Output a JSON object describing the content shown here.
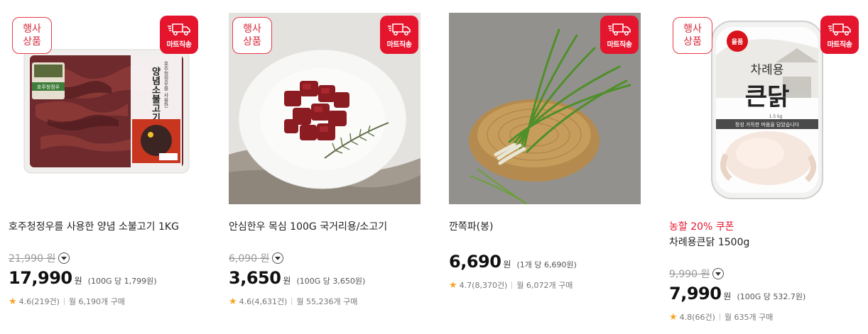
{
  "colors": {
    "accent_red": "#e5152e",
    "star": "#f5a623"
  },
  "products": [
    {
      "event_badge": [
        "행사",
        "상품"
      ],
      "delivery_badge": "마트직송",
      "title": "호주청정우를 사용한 양념 소불고기 1KG",
      "original_price": "21,990",
      "original_unit": "원",
      "price": "17,990",
      "price_unit": "원",
      "unit_price": "(100G 당 1,799원)",
      "rating": "4.6",
      "reviews": "(219건)",
      "monthly_sales": "월 6,190개 구매",
      "image_label": [
        "호주청정우를 사용한",
        "양념소불고기"
      ],
      "image_sublabel": "호주청정우"
    },
    {
      "event_badge": [
        "행사",
        "상품"
      ],
      "delivery_badge": "마트직송",
      "title": "안심한우 목심 100G 국거리용/소고기",
      "original_price": "6,090",
      "original_unit": "원",
      "price": "3,650",
      "price_unit": "원",
      "unit_price": "(100G 당 3,650원)",
      "rating": "4.6",
      "reviews": "(4,631건)",
      "monthly_sales": "월 55,236개 구매"
    },
    {
      "delivery_badge": "마트직송",
      "title": "깐쪽파(봉)",
      "price": "6,690",
      "price_unit": "원",
      "unit_price": "(1개 당 6,690원)",
      "rating": "4.7",
      "reviews": "(8,370건)",
      "monthly_sales": "월 6,072개 구매"
    },
    {
      "event_badge": [
        "행사",
        "상품"
      ],
      "delivery_badge": "마트직송",
      "coupon": "농할 20% 쿠폰",
      "title": "차례용큰닭 1500g",
      "original_price": "9,990",
      "original_unit": "원",
      "price": "7,990",
      "price_unit": "원",
      "unit_price": "(100G 당 532.7원)",
      "rating": "4.8",
      "reviews": "(66건)",
      "monthly_sales": "월 635개 구매",
      "image_brand": "올품",
      "image_label": [
        "차례용",
        "큰닭"
      ],
      "image_slogan": "정성 가득한 마음을 담았습니다",
      "image_weight": "1.5 kg"
    }
  ]
}
